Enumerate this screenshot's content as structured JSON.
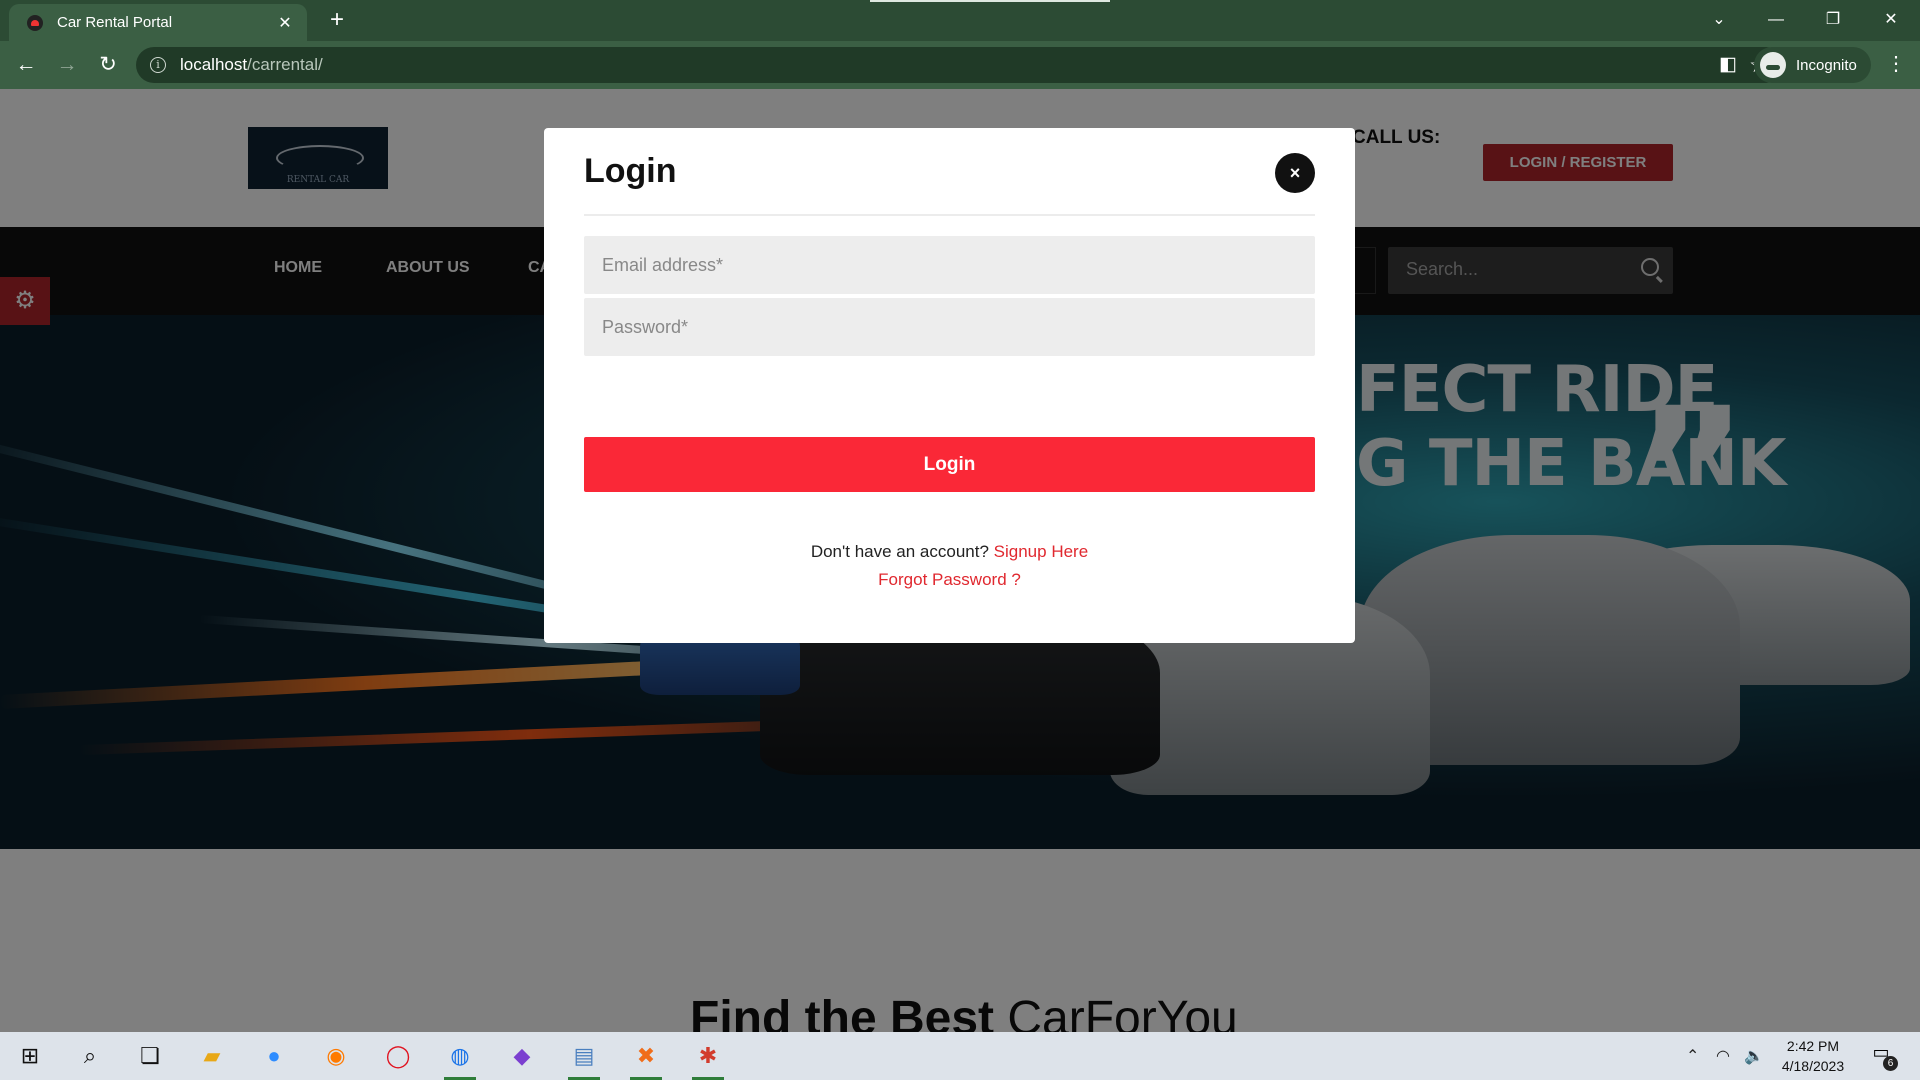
{
  "browser": {
    "tab_title": "Car Rental Portal",
    "new_tab": "+",
    "url_host": "localhost",
    "url_path": "/carrental/",
    "profile": "Incognito"
  },
  "site": {
    "logo_text": "RENTAL CAR",
    "call_us": "CALL US:",
    "login_register": "LOGIN / REGISTER",
    "nav": {
      "home": "HOME",
      "about": "ABOUT US",
      "partial": "CA"
    },
    "search_placeholder": "Search..."
  },
  "hero": {
    "line1": "FECT RIDE",
    "line2": "G THE BANK",
    "quote": "”"
  },
  "section": {
    "title_bold": "Find the Best",
    "title_light": "CarForYou"
  },
  "modal": {
    "title": "Login",
    "close": "×",
    "email_placeholder": "Email address*",
    "password_placeholder": "Password*",
    "submit_label": "Login",
    "no_account": "Don't have an account?",
    "signup_link": "Signup Here",
    "forgot_link": "Forgot Password ?"
  },
  "taskbar": {
    "time": "2:42 PM",
    "date": "4/18/2023",
    "notifications": "6"
  },
  "colors": {
    "accent_red": "#fa2837",
    "brand_red": "#b0242b",
    "chrome_green": "#3b5f44"
  }
}
